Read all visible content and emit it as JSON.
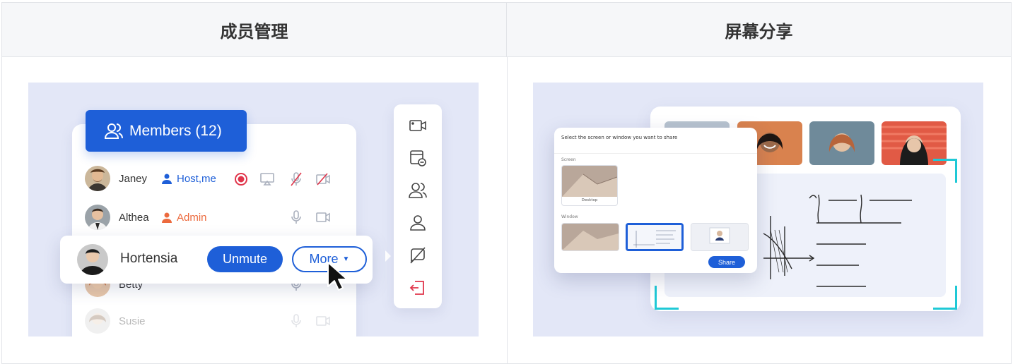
{
  "headers": {
    "left": "成员管理",
    "right": "屏幕分享"
  },
  "members_panel": {
    "tab_label": "Members (12)",
    "rows": [
      {
        "name": "Janey",
        "role": "Host,me",
        "role_color": "#1e5fd8"
      },
      {
        "name": "Althea",
        "role": "Admin",
        "role_color": "#ec6a3e"
      },
      {
        "name": "Betty"
      },
      {
        "name": "Susie"
      }
    ],
    "hover_row": {
      "name": "Hortensia",
      "unmute_label": "Unmute",
      "more_label": "More"
    },
    "toolbar_icons": [
      "camera-icon",
      "share-screen-icon",
      "members-icon",
      "profile-icon",
      "chat-off-icon",
      "exit-icon"
    ],
    "accent": "#1e5fd8",
    "danger": "#e0354b"
  },
  "share_panel": {
    "dialog_title": "Select the screen or window you want to share",
    "screen_label": "Screen",
    "desktop_caption": "Desktop",
    "window_label": "Window",
    "share_button": "Share",
    "frame_color": "#1fc9d6"
  }
}
